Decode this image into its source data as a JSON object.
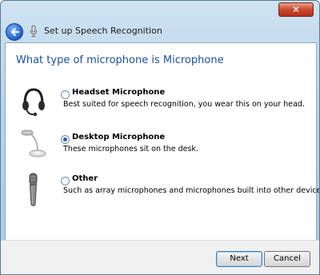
{
  "window": {
    "close_glyph": "✕"
  },
  "wizard": {
    "title": "Set up Speech Recognition"
  },
  "page": {
    "heading": "What type of microphone is Microphone"
  },
  "options": [
    {
      "label": "Headset Microphone",
      "description": "Best suited for speech recognition, you wear this on your head.",
      "selected": false,
      "icon": "headset-icon"
    },
    {
      "label": "Desktop Microphone",
      "description": "These microphones sit on the desk.",
      "selected": true,
      "icon": "desktop-microphone-icon"
    },
    {
      "label": "Other",
      "description": "Such as array microphones and microphones built into other devices.",
      "selected": false,
      "icon": "handheld-microphone-icon"
    }
  ],
  "buttons": {
    "next": "Next",
    "cancel": "Cancel"
  },
  "colors": {
    "heading": "#1f4e9e",
    "close": "#c9472b"
  }
}
